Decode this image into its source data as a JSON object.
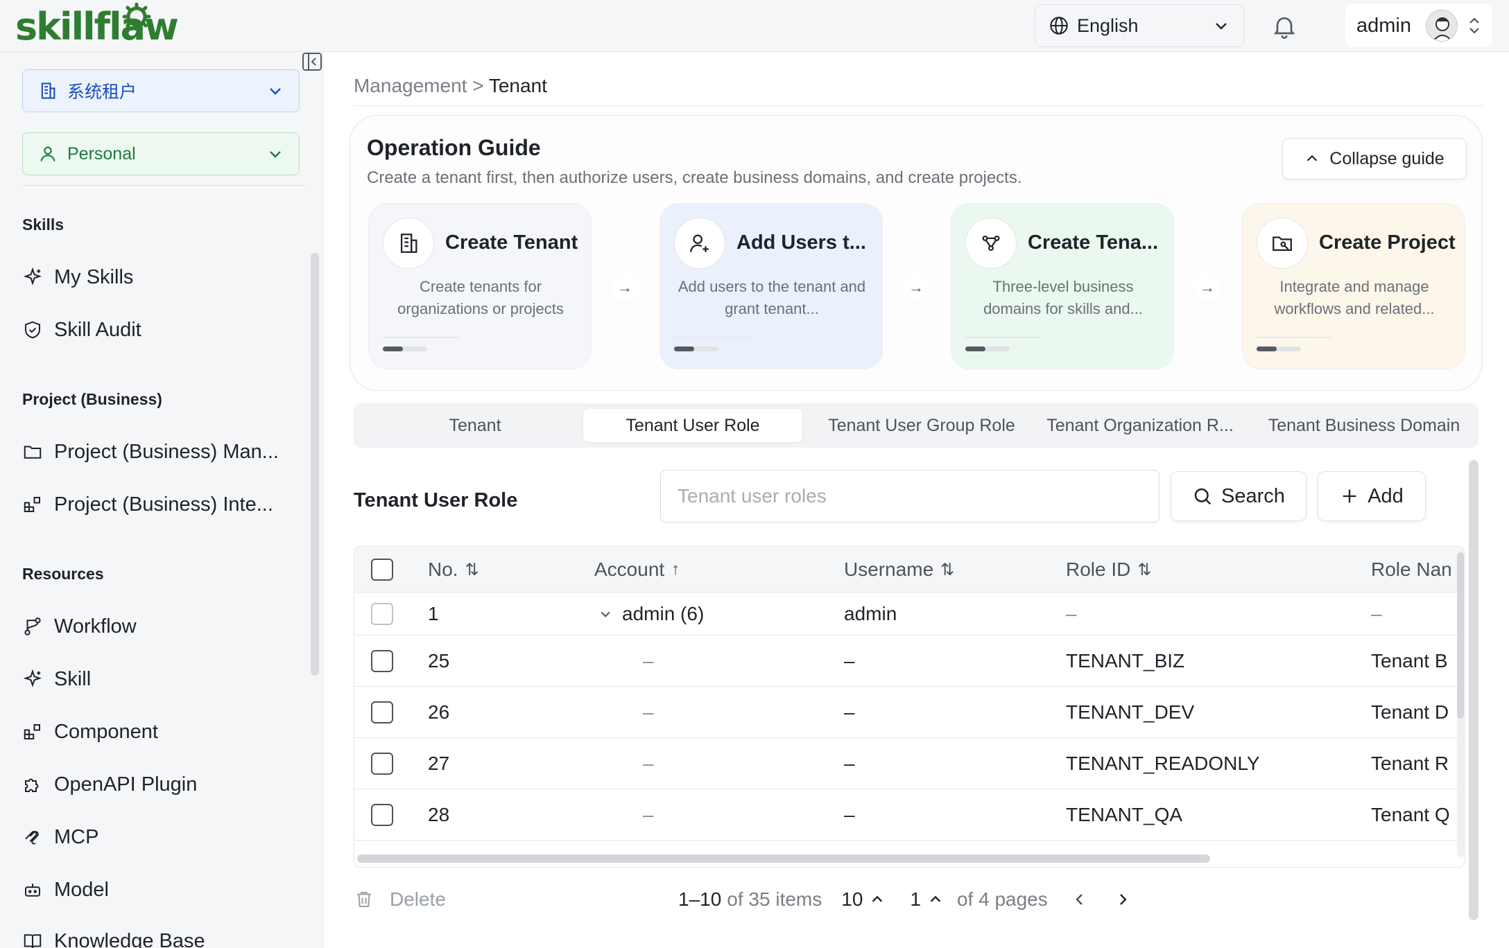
{
  "app": {
    "logo_text": "skillflaw",
    "brand_color": "#2e7d32"
  },
  "header": {
    "language": "English",
    "user": "admin"
  },
  "sidebar": {
    "tenant_select": "系统租户",
    "space_select": "Personal",
    "sections": [
      {
        "title": "Skills",
        "items": [
          {
            "label": "My Skills",
            "icon": "sparkle-icon"
          },
          {
            "label": "Skill Audit",
            "icon": "shield-check-icon"
          }
        ]
      },
      {
        "title": "Project (Business)",
        "items": [
          {
            "label": "Project (Business) Man...",
            "icon": "folder-icon"
          },
          {
            "label": "Project (Business) Inte...",
            "icon": "blocks-icon"
          }
        ]
      },
      {
        "title": "Resources",
        "items": [
          {
            "label": "Workflow",
            "icon": "workflow-icon"
          },
          {
            "label": "Skill",
            "icon": "sparkle-icon"
          },
          {
            "label": "Component",
            "icon": "blocks-icon"
          },
          {
            "label": "OpenAPI Plugin",
            "icon": "puzzle-icon"
          },
          {
            "label": "MCP",
            "icon": "mcp-icon"
          },
          {
            "label": "Model",
            "icon": "robot-icon"
          },
          {
            "label": "Knowledge Base",
            "icon": "book-icon"
          }
        ]
      }
    ]
  },
  "breadcrumb": {
    "parent": "Management",
    "separator": ">",
    "current": "Tenant"
  },
  "guide": {
    "title": "Operation Guide",
    "subtitle": "Create a tenant first, then authorize users, create business domains, and create projects.",
    "collapse_label": "Collapse guide",
    "cards": [
      {
        "title": "Create Tenant",
        "desc": "Create tenants for organizations or projects",
        "bg": "#f4f6fa",
        "icon": "building-icon"
      },
      {
        "title": "Add Users t...",
        "desc": "Add users to the tenant and grant tenant...",
        "bg": "#eaf0fc",
        "icon": "user-add-icon"
      },
      {
        "title": "Create Tena...",
        "desc": "Three-level business domains for skills and...",
        "bg": "#eaf8ef",
        "icon": "network-icon"
      },
      {
        "title": "Create Project",
        "desc": "Integrate and manage workflows and related...",
        "bg": "#fdf6ea",
        "icon": "project-icon"
      }
    ],
    "progress": [
      0.45,
      0.45,
      0.45,
      0.45
    ]
  },
  "tabs": [
    {
      "label": "Tenant",
      "active": false
    },
    {
      "label": "Tenant User Role",
      "active": true
    },
    {
      "label": "Tenant User Group Role",
      "active": false
    },
    {
      "label": "Tenant Organization R...",
      "active": false
    },
    {
      "label": "Tenant Business Domain",
      "active": false
    }
  ],
  "section": {
    "title": "Tenant User Role",
    "search_placeholder": "Tenant user roles",
    "search_label": "Search",
    "add_label": "Add"
  },
  "table": {
    "columns": [
      {
        "label": "No.",
        "sort": "⇅"
      },
      {
        "label": "Account",
        "sort": "↑"
      },
      {
        "label": "Username",
        "sort": "⇅"
      },
      {
        "label": "Role ID",
        "sort": "⇅"
      },
      {
        "label": "Role Nan",
        "sort": ""
      }
    ],
    "rows": [
      {
        "no": "1",
        "account": "admin (6)",
        "username": "admin",
        "role_id": "–",
        "role_name": "–",
        "group": true
      },
      {
        "no": "25",
        "account": "–",
        "username": "–",
        "role_id": "TENANT_BIZ",
        "role_name": "Tenant B"
      },
      {
        "no": "26",
        "account": "–",
        "username": "–",
        "role_id": "TENANT_DEV",
        "role_name": "Tenant D"
      },
      {
        "no": "27",
        "account": "–",
        "username": "–",
        "role_id": "TENANT_READONLY",
        "role_name": "Tenant R"
      },
      {
        "no": "28",
        "account": "–",
        "username": "–",
        "role_id": "TENANT_QA",
        "role_name": "Tenant Q"
      }
    ]
  },
  "footer": {
    "delete_label": "Delete",
    "range": "1–10",
    "of_items": "of 35 items",
    "page_size": "10",
    "page": "1",
    "of_pages": "of 4 pages"
  }
}
